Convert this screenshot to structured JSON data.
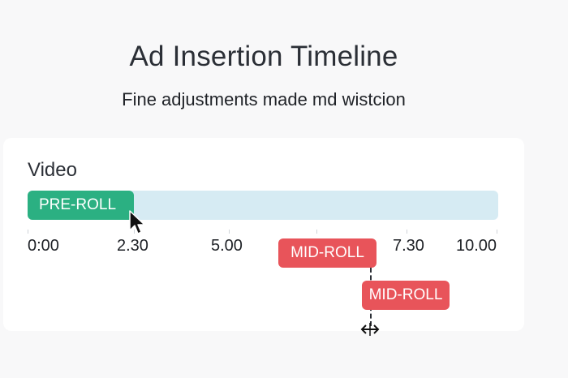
{
  "header": {
    "title": "Ad Insertion Timeline",
    "subtitle": "Fine adjustments made md wistcion"
  },
  "timeline": {
    "track_label": "Video",
    "ticks": [
      "0:00",
      "2.30",
      "5.00",
      "7.30",
      "10.00"
    ],
    "segments": {
      "pre_roll": "PRE-ROLL",
      "mid_roll_primary": "MID-ROLL",
      "mid_roll_dragging": "MID-ROLL"
    }
  },
  "icons": {
    "cursor": "arrow-pointer-icon",
    "resize": "horizontal-resize-icon"
  },
  "colors": {
    "pre_roll": "#2bb082",
    "mid_roll": "#e8545a",
    "track": "#d6ebf3",
    "background": "#f8f8f9",
    "card": "#ffffff"
  }
}
